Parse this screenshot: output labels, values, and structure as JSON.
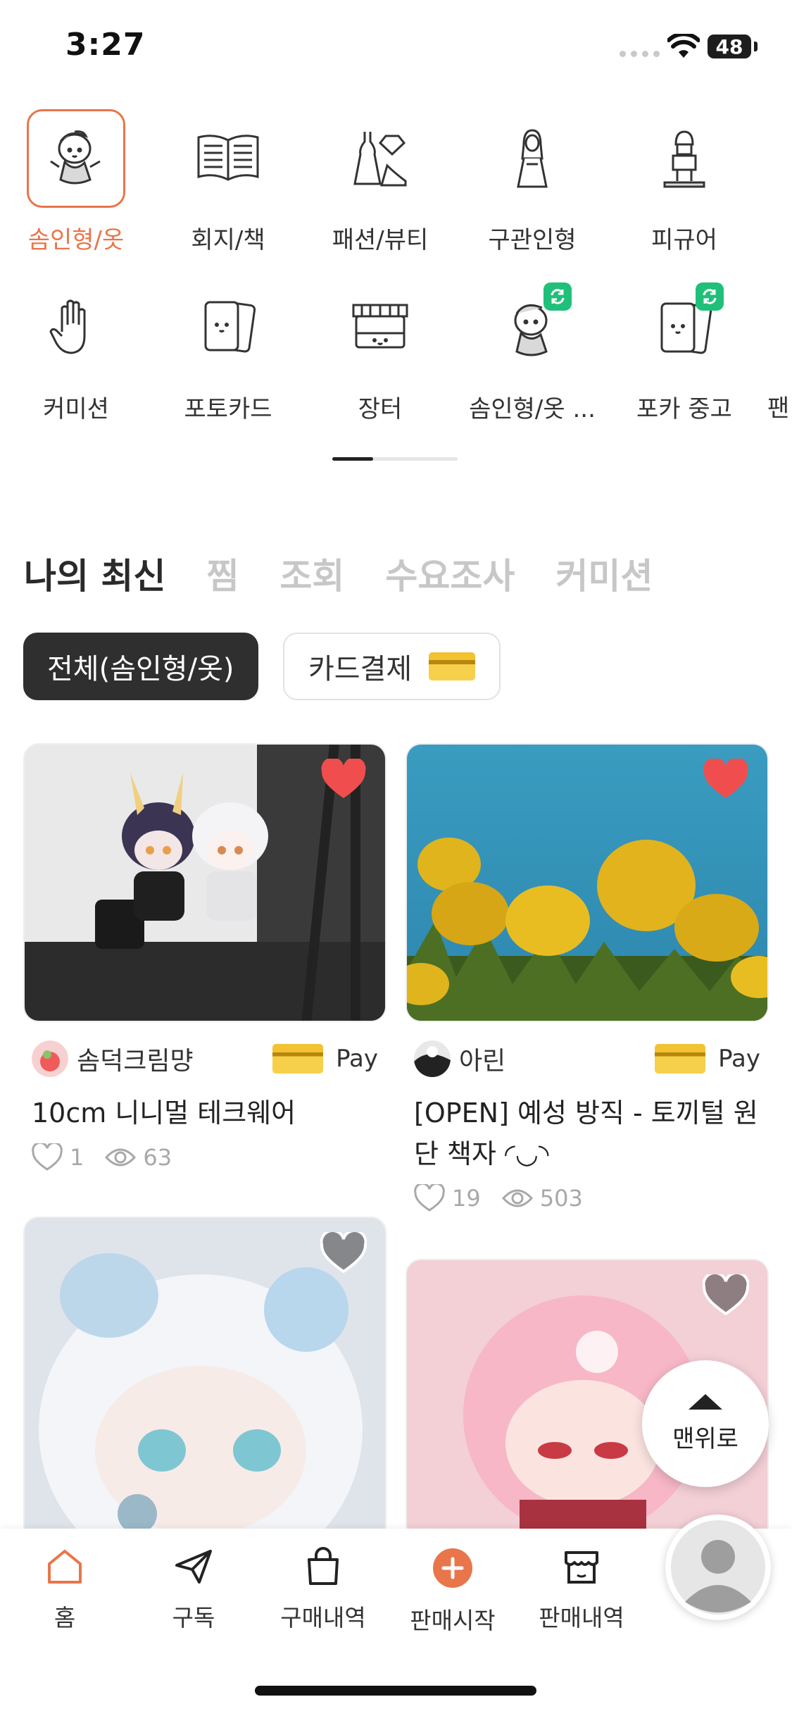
{
  "status_bar": {
    "time": "3:27",
    "battery": "48"
  },
  "categories": [
    {
      "label": "솜인형/옷",
      "icon": "doll-icon",
      "active": true
    },
    {
      "label": "회지/책",
      "icon": "book-icon"
    },
    {
      "label": "패션/뷰티",
      "icon": "dress-gem-icon"
    },
    {
      "label": "구관인형",
      "icon": "ball-jointed-doll-icon"
    },
    {
      "label": "피규어",
      "icon": "figure-icon"
    },
    {
      "label": "커미션",
      "icon": "hand-icon"
    },
    {
      "label": "포토카드",
      "icon": "photocard-icon"
    },
    {
      "label": "장터",
      "icon": "market-stall-icon"
    },
    {
      "label": "솜인형/옷 ...",
      "icon": "doll-swap-icon"
    },
    {
      "label": "포카 중고",
      "icon": "photocard-swap-icon"
    },
    {
      "label": "팬",
      "icon": ""
    }
  ],
  "tabs": [
    {
      "label": "나의 최신",
      "active": true
    },
    {
      "label": "찜"
    },
    {
      "label": "조회"
    },
    {
      "label": "수요조사"
    },
    {
      "label": "커미션"
    }
  ],
  "filters": {
    "category_chip": "전체(솜인형/옷)",
    "card_chip": "카드결제"
  },
  "products": [
    {
      "seller": "솜덕크림먕",
      "pay": "Pay",
      "title": "10cm 니니멀 테크웨어",
      "likes": "1",
      "views": "63",
      "liked": true
    },
    {
      "seller": "아린",
      "pay": "Pay",
      "title": "[OPEN] 예성 방직 - 토끼털 원단 책자 ◜◡◝",
      "likes": "19",
      "views": "503",
      "liked": true
    },
    {
      "seller": "",
      "title": "",
      "liked": false
    },
    {
      "seller": "",
      "title": "",
      "liked": false
    }
  ],
  "scroll_top": {
    "label": "맨위로"
  },
  "bottom_nav": [
    {
      "label": "홈",
      "icon": "home-icon",
      "active": true
    },
    {
      "label": "구독",
      "icon": "paper-plane-icon"
    },
    {
      "label": "구매내역",
      "icon": "shopping-bag-icon"
    },
    {
      "label": "판매시작",
      "icon": "plus-circle-icon"
    },
    {
      "label": "판매내역",
      "icon": "store-icon"
    }
  ],
  "colors": {
    "accent": "#e8764a",
    "heart": "#f04e4e",
    "swap_badge": "#20c07a"
  }
}
